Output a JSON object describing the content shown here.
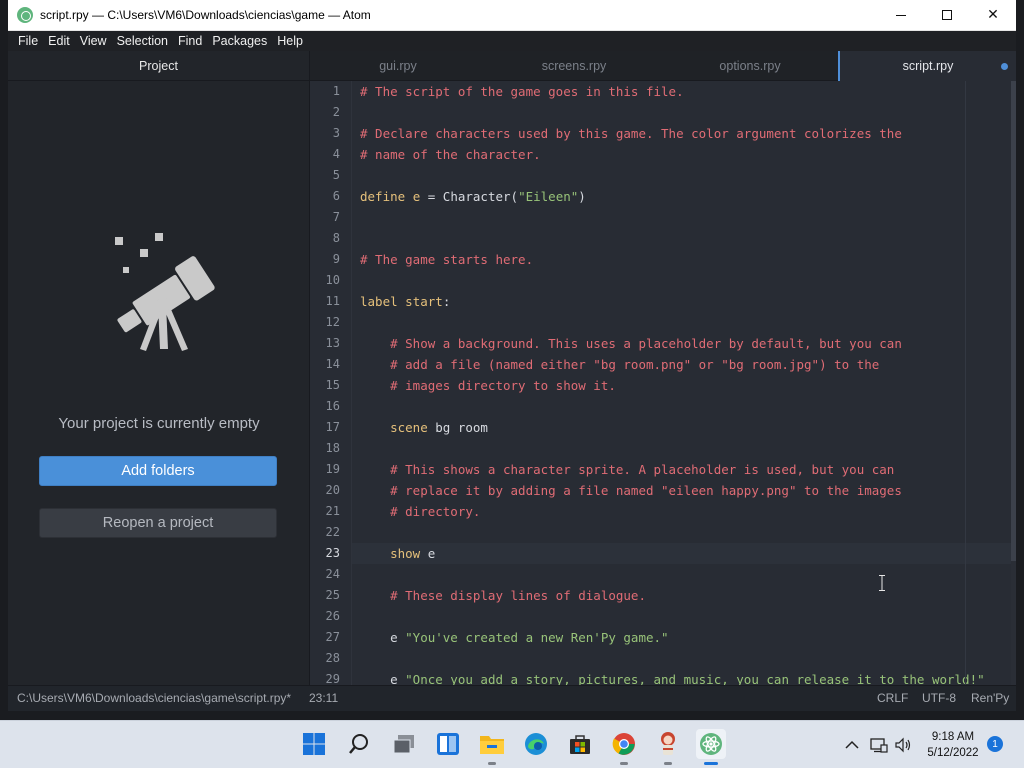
{
  "window": {
    "title": "script.rpy — C:\\Users\\VM6\\Downloads\\ciencias\\game — Atom",
    "minimize_label": "minimize",
    "maximize_label": "maximize",
    "close_label": "✕"
  },
  "menu": [
    "File",
    "Edit",
    "View",
    "Selection",
    "Find",
    "Packages",
    "Help"
  ],
  "tree": {
    "tab_label": "Project",
    "empty_message": "Your project is currently empty",
    "add_folders_label": "Add folders",
    "reopen_label": "Reopen a project"
  },
  "tabs": [
    {
      "label": "gui.rpy",
      "active": false
    },
    {
      "label": "screens.rpy",
      "active": false
    },
    {
      "label": "options.rpy",
      "active": false
    },
    {
      "label": "script.rpy",
      "active": true,
      "modified": true
    }
  ],
  "editor": {
    "current_line": 23,
    "lines": [
      [
        {
          "t": "# The script of the game goes in this file.",
          "c": "com"
        }
      ],
      [],
      [
        {
          "t": "# Declare characters used by this game. The color argument colorizes the",
          "c": "com"
        }
      ],
      [
        {
          "t": "# name of the character.",
          "c": "com"
        }
      ],
      [],
      [
        {
          "t": "define",
          "c": "kw"
        },
        {
          "t": " ",
          "c": "txt"
        },
        {
          "t": "e",
          "c": "kw"
        },
        {
          "t": " = Character(",
          "c": "txt"
        },
        {
          "t": "\"Eileen\"",
          "c": "str"
        },
        {
          "t": ")",
          "c": "txt"
        }
      ],
      [],
      [],
      [
        {
          "t": "# The game starts here.",
          "c": "com"
        }
      ],
      [],
      [
        {
          "t": "label",
          "c": "kw"
        },
        {
          "t": " ",
          "c": "txt"
        },
        {
          "t": "start",
          "c": "kw"
        },
        {
          "t": ":",
          "c": "txt"
        }
      ],
      [],
      [
        {
          "t": "    # Show a background. This uses a placeholder by default, but you can",
          "c": "com"
        }
      ],
      [
        {
          "t": "    # add a file (named either \"bg room.png\" or \"bg room.jpg\") to the",
          "c": "com"
        }
      ],
      [
        {
          "t": "    # images directory to show it.",
          "c": "com"
        }
      ],
      [],
      [
        {
          "t": "    ",
          "c": "txt"
        },
        {
          "t": "scene",
          "c": "kw"
        },
        {
          "t": " bg room",
          "c": "txt"
        }
      ],
      [],
      [
        {
          "t": "    # This shows a character sprite. A placeholder is used, but you can",
          "c": "com"
        }
      ],
      [
        {
          "t": "    # replace it by adding a file named \"eileen happy.png\" to the images",
          "c": "com"
        }
      ],
      [
        {
          "t": "    # directory.",
          "c": "com"
        }
      ],
      [],
      [
        {
          "t": "    ",
          "c": "txt"
        },
        {
          "t": "show",
          "c": "kw"
        },
        {
          "t": " e",
          "c": "txt"
        }
      ],
      [],
      [
        {
          "t": "    # These display lines of dialogue.",
          "c": "com"
        }
      ],
      [],
      [
        {
          "t": "    e ",
          "c": "txt"
        },
        {
          "t": "\"You've created a new Ren'Py game.\"",
          "c": "str"
        }
      ],
      [],
      [
        {
          "t": "    e ",
          "c": "txt"
        },
        {
          "t": "\"Once you add a story, pictures, and music, you can release it to the world!\"",
          "c": "str"
        }
      ]
    ]
  },
  "status": {
    "path": "C:\\Users\\VM6\\Downloads\\ciencias\\game\\script.rpy*",
    "cursor": "23:11",
    "line_ending": "CRLF",
    "encoding": "UTF-8",
    "grammar": "Ren'Py"
  },
  "taskbar": {
    "time": "9:18 AM",
    "date": "5/12/2022",
    "notifications": "1",
    "icons": [
      "windows-start-icon",
      "search-icon",
      "task-view-icon",
      "widgets-icon",
      "file-explorer-icon",
      "edge-icon",
      "store-icon",
      "chrome-icon",
      "renpy-icon",
      "atom-icon"
    ]
  },
  "colors": {
    "accent": "#4a90d9",
    "comment": "#e06c75",
    "keyword": "#e5c07b",
    "string": "#98c379"
  }
}
